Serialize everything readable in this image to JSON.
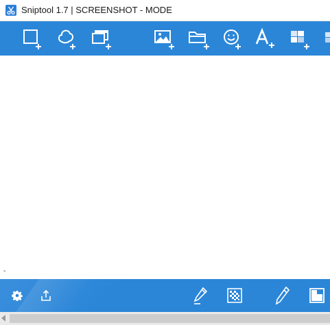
{
  "window": {
    "title": "Sniptool 1.7 | SCREENSHOT - MODE",
    "app_icon": "scissors-icon"
  },
  "toolbar": {
    "color": "#2b86d8",
    "tools": [
      {
        "name": "rectangle-snip-icon"
      },
      {
        "name": "freeform-snip-icon"
      },
      {
        "name": "window-snip-icon"
      },
      {
        "name": "add-image-icon"
      },
      {
        "name": "open-folder-icon"
      },
      {
        "name": "add-emoji-icon"
      },
      {
        "name": "add-text-icon"
      },
      {
        "name": "add-grid-icon"
      }
    ]
  },
  "canvas": {
    "marker_text": "-"
  },
  "bottombar": {
    "buttons": [
      {
        "name": "settings-gear-icon"
      },
      {
        "name": "share-upload-icon"
      },
      {
        "name": "highlighter-icon"
      },
      {
        "name": "pixelate-checker-icon"
      },
      {
        "name": "pencil-icon"
      },
      {
        "name": "color-swatch-icon"
      }
    ]
  }
}
